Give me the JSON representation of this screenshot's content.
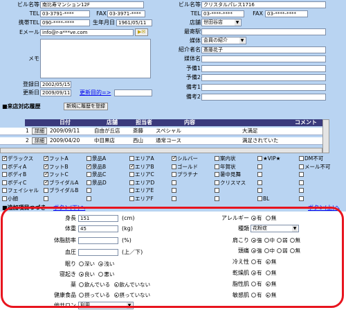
{
  "left_info": {
    "building": {
      "label": "ビル名等",
      "value": "南比寿マンション12F"
    },
    "tel": {
      "label": "TEL",
      "value": "03-3791-****"
    },
    "fax": {
      "label": "FAX",
      "value": "03-3971-****"
    },
    "mobile": {
      "label": "携帯TEL",
      "value": "090-****-****"
    },
    "birth": {
      "label": "生年月日",
      "value": "1961/05/11"
    },
    "email": {
      "label": "Eメール",
      "value": "info@r-a***ve.com"
    },
    "email_btn": "▶✉",
    "memo": {
      "label": "メモ",
      "value": ""
    },
    "registered": {
      "label": "登録日",
      "value": "2002/05/15"
    },
    "updated": {
      "label": "更新日",
      "value": "2009/09/11"
    },
    "update_purpose_link": "更新目的=>"
  },
  "right_info": {
    "building": {
      "label": "ビル名等",
      "value": "クリスタルパレス1716"
    },
    "tel": {
      "label": "TEL",
      "value": "03-****-****"
    },
    "fax": {
      "label": "FAX",
      "value": "03-****-****"
    },
    "store": {
      "label": "店舗",
      "value": "世田谷店"
    },
    "nearest_station": {
      "label": "最寄駅",
      "value": ""
    },
    "media": {
      "label": "媒体",
      "value": "会員の紹介"
    },
    "referrer": {
      "label": "紹介者名",
      "value": "斎藤花子"
    },
    "media_name": {
      "label": "媒体名",
      "value": ""
    },
    "yobi1": {
      "label": "予備1",
      "value": ""
    },
    "yobi2": {
      "label": "予備2",
      "value": ""
    },
    "note1": {
      "label": "備考1",
      "value": ""
    },
    "note2": {
      "label": "備考2",
      "value": ""
    }
  },
  "history": {
    "section_title": "■来店対応履歴",
    "new_button": "新規に履歴を登録",
    "columns": {
      "date": "日付",
      "store": "店舗",
      "staff": "担当者",
      "content": "内容",
      "comment": "コメント"
    },
    "rows": [
      {
        "no": "1",
        "detail": "詳細",
        "date": "2009/09/11",
        "store": "自由が丘店",
        "staff": "斎藤",
        "content": "スペシャル",
        "comment": "大満足"
      },
      {
        "no": "2",
        "detail": "詳細",
        "date": "2009/04/20",
        "store": "中目黒店",
        "staff": "西山",
        "content": "通常コース",
        "comment": "満足されていた"
      }
    ]
  },
  "checkboxes": [
    [
      {
        "label": "デラックス",
        "on": true
      },
      {
        "label": "フットA",
        "on": true
      },
      {
        "label": "景品A",
        "on": false
      },
      {
        "label": "エリアA",
        "on": false
      },
      {
        "label": "シルバー",
        "on": true
      },
      {
        "label": "案内状",
        "on": false
      },
      {
        "label": "★VIP★",
        "on": false
      },
      {
        "label": "DM不可",
        "on": false
      }
    ],
    [
      {
        "label": "ボディA",
        "on": false
      },
      {
        "label": "フットB",
        "on": true
      },
      {
        "label": "景品B",
        "on": true
      },
      {
        "label": "エリアB",
        "on": true
      },
      {
        "label": "ゴールド",
        "on": false
      },
      {
        "label": "年賀状",
        "on": false
      },
      {
        "label": "",
        "on": false
      },
      {
        "label": "メール不可",
        "on": false
      }
    ],
    [
      {
        "label": "ボディB",
        "on": false
      },
      {
        "label": "フットC",
        "on": true
      },
      {
        "label": "景品C",
        "on": false
      },
      {
        "label": "エリアC",
        "on": false
      },
      {
        "label": "プラチナ",
        "on": false
      },
      {
        "label": "暑中見舞",
        "on": false
      },
      {
        "label": "",
        "on": false
      },
      {
        "label": "",
        "on": false
      }
    ],
    [
      {
        "label": "ボディC",
        "on": false
      },
      {
        "label": "ブライダルA",
        "on": true
      },
      {
        "label": "景品D",
        "on": false
      },
      {
        "label": "エリアD",
        "on": false
      },
      {
        "label": "",
        "on": false
      },
      {
        "label": "クリスマス",
        "on": false
      },
      {
        "label": "",
        "on": false
      },
      {
        "label": "",
        "on": false
      }
    ],
    [
      {
        "label": "フェイシャル",
        "on": false
      },
      {
        "label": "ブライダルB",
        "on": false
      },
      {
        "label": "",
        "on": false
      },
      {
        "label": "エリアE",
        "on": false
      },
      {
        "label": "",
        "on": false
      },
      {
        "label": "",
        "on": false
      },
      {
        "label": "",
        "on": false
      },
      {
        "label": "",
        "on": false
      }
    ],
    [
      {
        "label": "小顔",
        "on": false
      },
      {
        "label": "",
        "on": false
      },
      {
        "label": "",
        "on": false
      },
      {
        "label": "エリアF",
        "on": false
      },
      {
        "label": "",
        "on": false
      },
      {
        "label": "",
        "on": false
      },
      {
        "label": "BL",
        "on": false
      },
      {
        "label": "",
        "on": false
      }
    ]
  ],
  "extra": {
    "section_title": "■追加項目つづき",
    "bottom_link": "ボタン(下)へ",
    "top_link": "ボタン(上)へ",
    "height": {
      "label": "身長",
      "value": "151",
      "unit": "(cm)"
    },
    "weight": {
      "label": "体重",
      "value": "45",
      "unit": "(kg)"
    },
    "fat": {
      "label": "体脂肪率",
      "value": "",
      "unit": "(%)"
    },
    "bp": {
      "label": "血圧",
      "value": "",
      "unit": "(上／下)"
    },
    "sleep": {
      "label": "眠り",
      "opt1": "深い",
      "opt2": "浅い"
    },
    "waking": {
      "label": "寝起き",
      "opt1": "良い",
      "opt2": "悪い"
    },
    "medicine": {
      "label": "薬",
      "opt1": "飲んでいる",
      "opt2": "飲んでいない"
    },
    "health_food": {
      "label": "健康食品",
      "opt1": "摂っている",
      "opt2": "摂っていない"
    },
    "salon": {
      "label": "他サロン",
      "value": "利用"
    },
    "allergy": {
      "label": "アレルギー",
      "opt1": "有",
      "opt2": "無"
    },
    "allergy_type": {
      "label": "種類",
      "value": "花粉症"
    },
    "shoulder": {
      "label": "肩こり",
      "opt1": "強",
      "opt2": "中",
      "opt3": "弱",
      "opt4": "無"
    },
    "headache": {
      "label": "頭痛",
      "opt1": "強",
      "opt2": "中",
      "opt3": "弱",
      "opt4": "無"
    },
    "cold": {
      "label": "冷え性",
      "opt1": "有",
      "opt2": "無"
    },
    "dry": {
      "label": "乾燥肌",
      "opt1": "有",
      "opt2": "無"
    },
    "oily": {
      "label": "脂性肌",
      "opt1": "有",
      "opt2": "無"
    },
    "sensitive": {
      "label": "敏感肌",
      "opt1": "有",
      "opt2": "無"
    }
  }
}
